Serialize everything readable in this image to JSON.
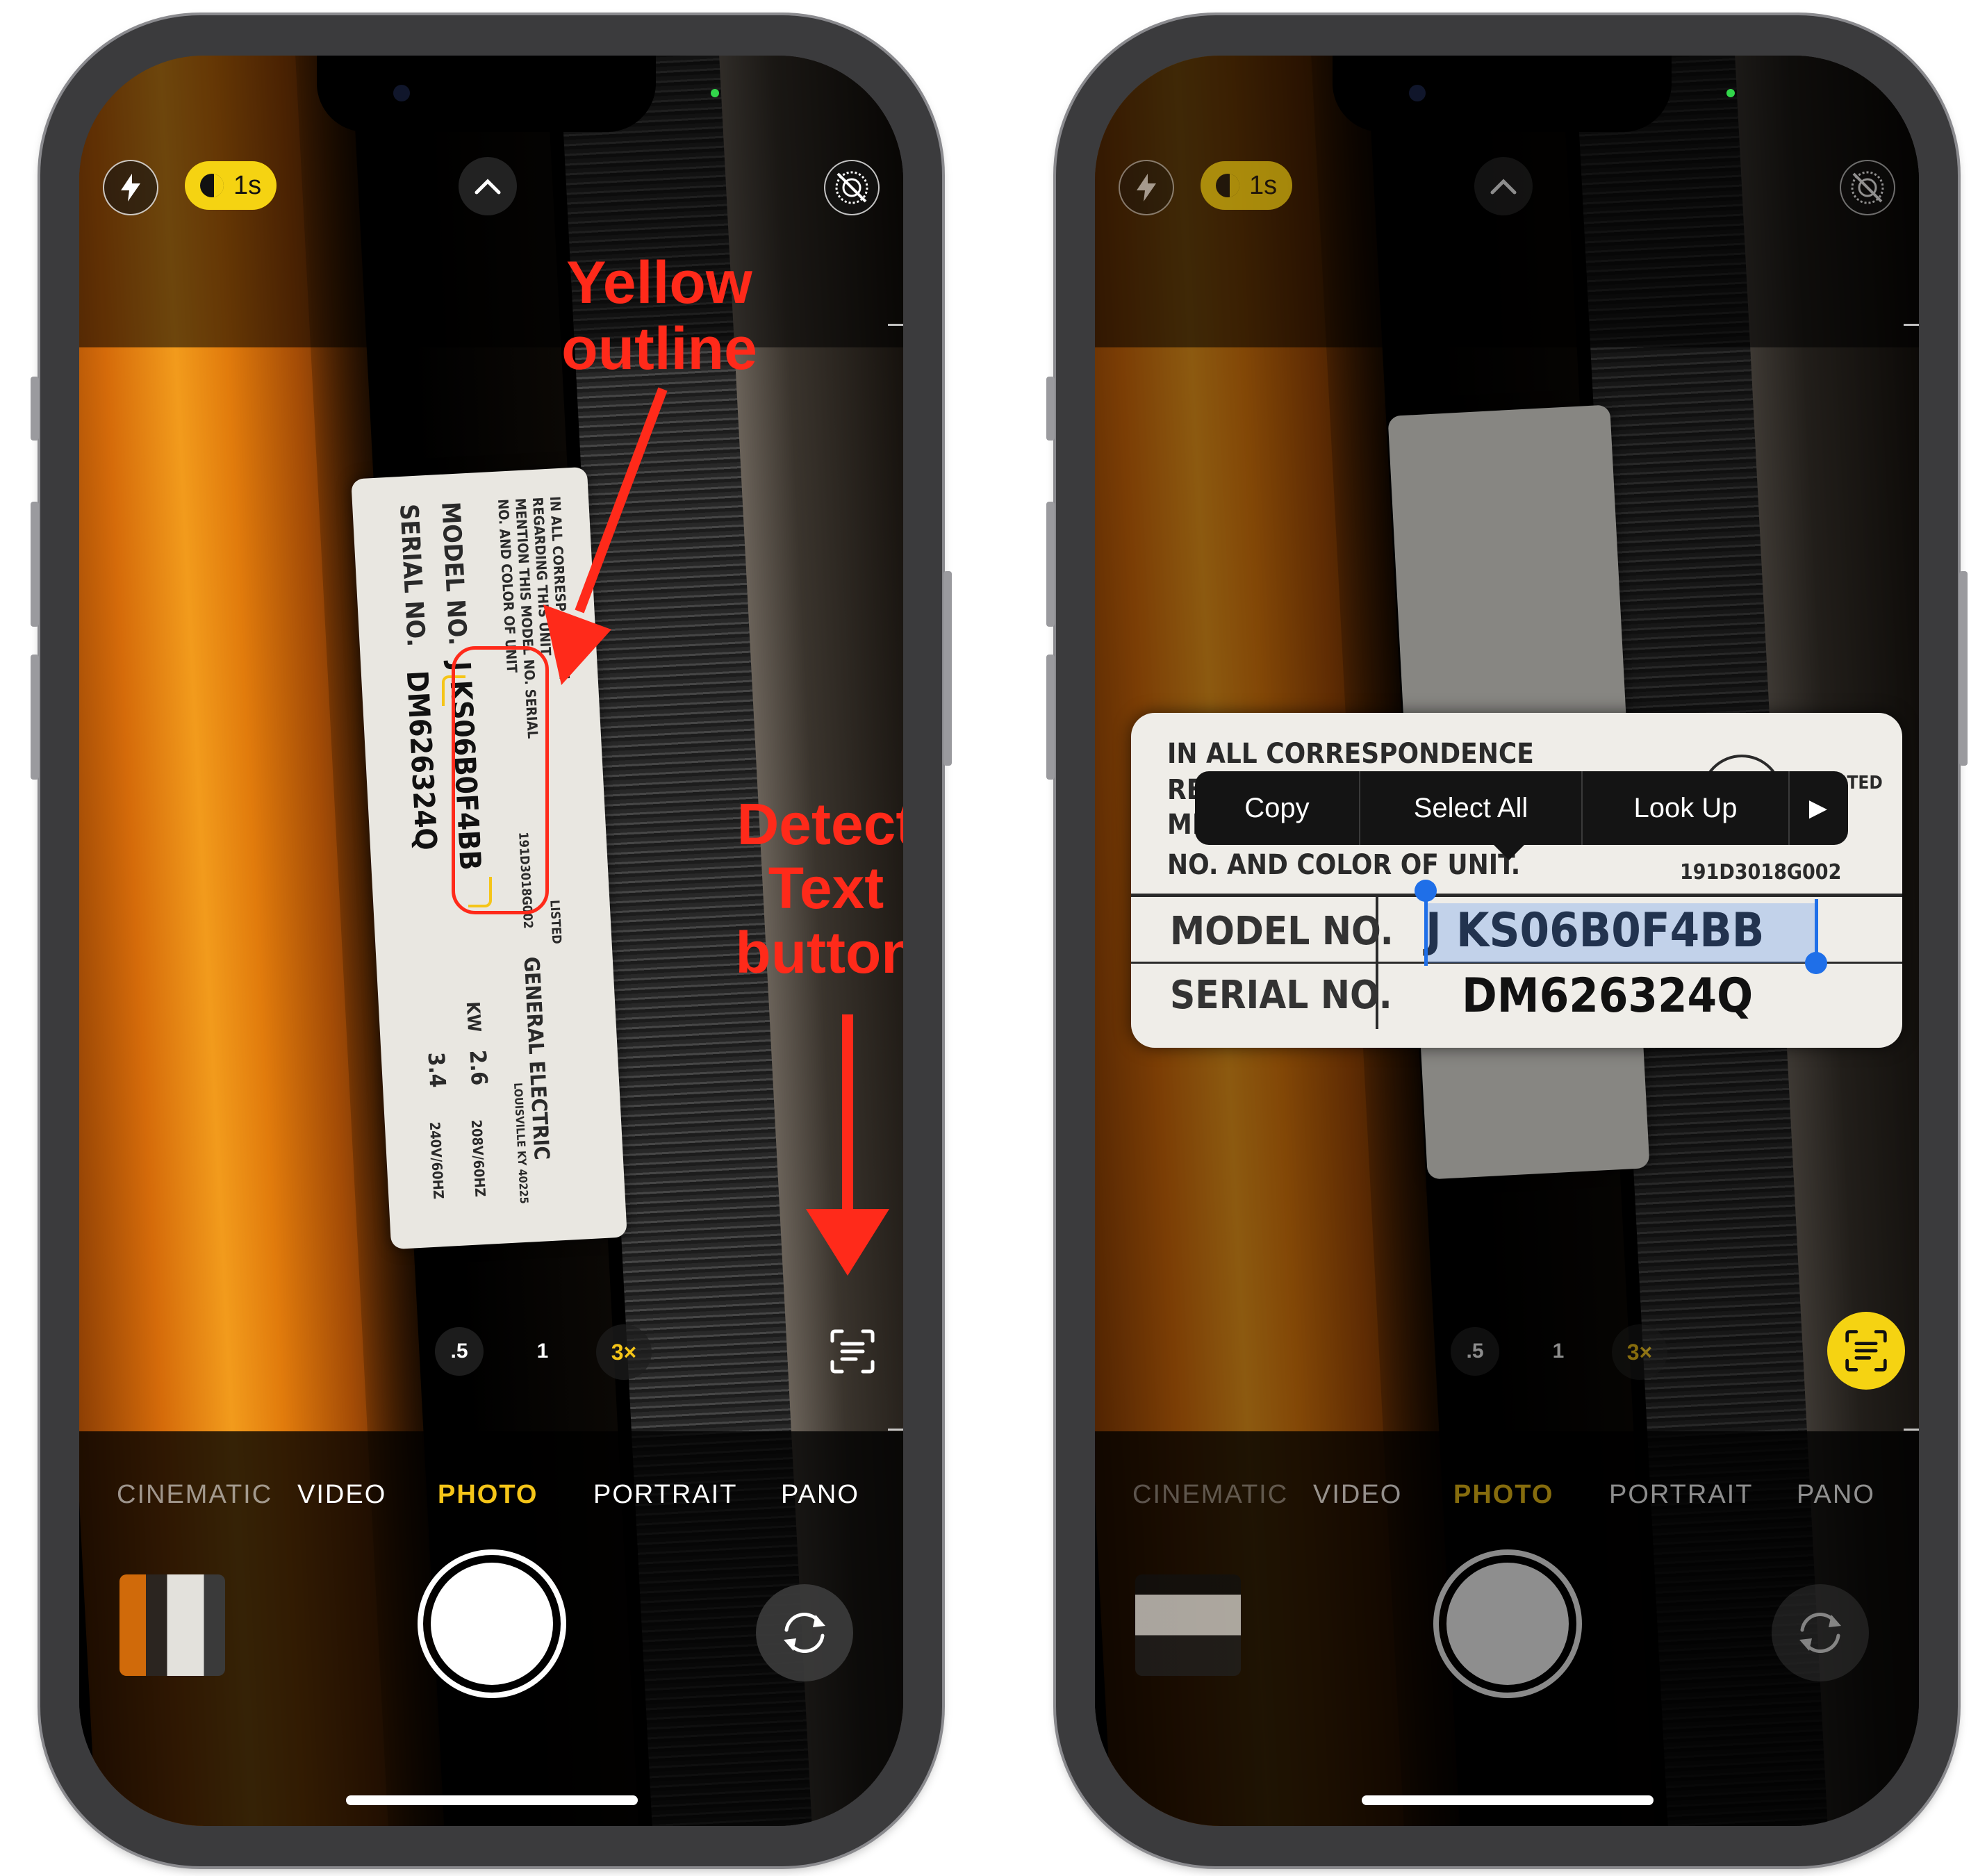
{
  "left_phone": {
    "top_controls": {
      "live_duration": "1s"
    },
    "annotation_outline": "Yellow\noutline",
    "annotation_detect": "Detect\nText\nbutton",
    "zoom": {
      "half": ".5",
      "one": "1",
      "three": "3×"
    },
    "modes": [
      "CINEMATIC",
      "VIDEO",
      "PHOTO",
      "PORTRAIT",
      "PANO"
    ],
    "sticker": {
      "line1": "IN ALL CORRESPONDENCE",
      "line2": "REGARDING THIS UNIT",
      "line3": "MENTION THIS MODEL NO. SERIAL",
      "line4": "NO. AND COLOR OF UNIT",
      "model_label": "MODEL NO.",
      "serial_label": "SERIAL NO.",
      "model": "J KS06B0F4BB",
      "serial": "DM626324Q",
      "kw_label": "KW",
      "kw1": "2.6",
      "kw2": "3.4",
      "volts1": "208V/60HZ",
      "volts2": "240V/60HZ",
      "brand": "GENERAL ELECTRIC",
      "city": "LOUISVILLE KY 40225",
      "listed": "LISTED",
      "code": "191D3018G002"
    }
  },
  "right_phone": {
    "top_controls": {
      "live_duration": "1s"
    },
    "zoomed_label": {
      "line1": "IN ALL CORRESPONDENCE",
      "line2_prefix": "RE",
      "line3_prefix": "ME",
      "line4": "NO. AND COLOR OF UNIT.",
      "code": "191D3018G002",
      "model_label": "MODEL NO.",
      "serial_label": "SERIAL NO.",
      "model": "J KS06B0F4BB",
      "serial": "DM626324Q",
      "listed": "LISTED"
    },
    "context_menu": {
      "copy": "Copy",
      "select_all": "Select All",
      "look_up": "Look Up",
      "more": "▶"
    },
    "zoom": {
      "half": ".5",
      "one": "1",
      "three": "3×"
    },
    "modes": [
      "CINEMATIC",
      "VIDEO",
      "PHOTO",
      "PORTRAIT",
      "PANO"
    ]
  },
  "colors": {
    "accent_yellow": "#f5c518",
    "annotation_red": "#ff2a1a",
    "selection_blue": "#1f6fe8"
  }
}
